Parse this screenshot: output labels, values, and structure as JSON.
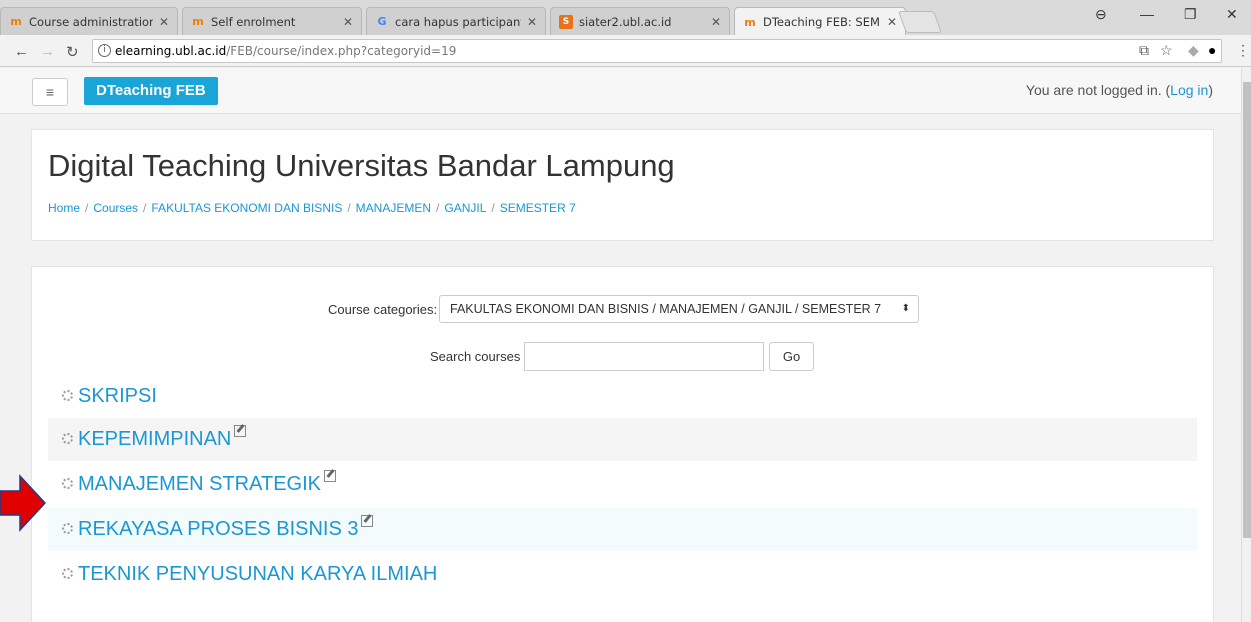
{
  "browser": {
    "tabs": [
      {
        "title": "Course administration",
        "icon": "moodle-icon"
      },
      {
        "title": "Self enrolment",
        "icon": "moodle-icon"
      },
      {
        "title": "cara hapus participant di",
        "icon": "google-icon"
      },
      {
        "title": "siater2.ubl.ac.id",
        "icon": "site-icon"
      },
      {
        "title": "DTeaching FEB: SEMESTE",
        "icon": "moodle-icon"
      }
    ],
    "url_host": "elearning.ubl.ac.id",
    "url_path": "/FEB/course/index.php?categoryid=19"
  },
  "navbar": {
    "menu_icon": "≡",
    "brand": "DTeaching FEB",
    "login_text": "You are not logged in. (",
    "login_link": "Log in",
    "login_close": ")"
  },
  "header": {
    "title": "Digital Teaching Universitas Bandar Lampung",
    "breadcrumb": [
      "Home",
      "Courses",
      "FAKULTAS EKONOMI DAN BISNIS",
      "MANAJEMEN",
      "GANJIL",
      "SEMESTER 7"
    ]
  },
  "main": {
    "categories_label": "Course categories:",
    "categories_value": "FAKULTAS EKONOMI DAN BISNIS / MANAJEMEN / GANJIL / SEMESTER 7",
    "search_label": "Search courses",
    "search_value": "",
    "go_label": "Go",
    "courses": [
      {
        "name": "SKRIPSI",
        "editable": false
      },
      {
        "name": "KEPEMIMPINAN",
        "editable": true
      },
      {
        "name": "MANAJEMEN STRATEGIK",
        "editable": true
      },
      {
        "name": "REKAYASA PROSES BISNIS 3",
        "editable": true
      },
      {
        "name": "TEKNIK PENYUSUNAN KARYA ILMIAH",
        "editable": false
      }
    ]
  },
  "colors": {
    "brand": "#1aa5d9",
    "link": "#1a97d4",
    "arrow": "#e00000"
  }
}
